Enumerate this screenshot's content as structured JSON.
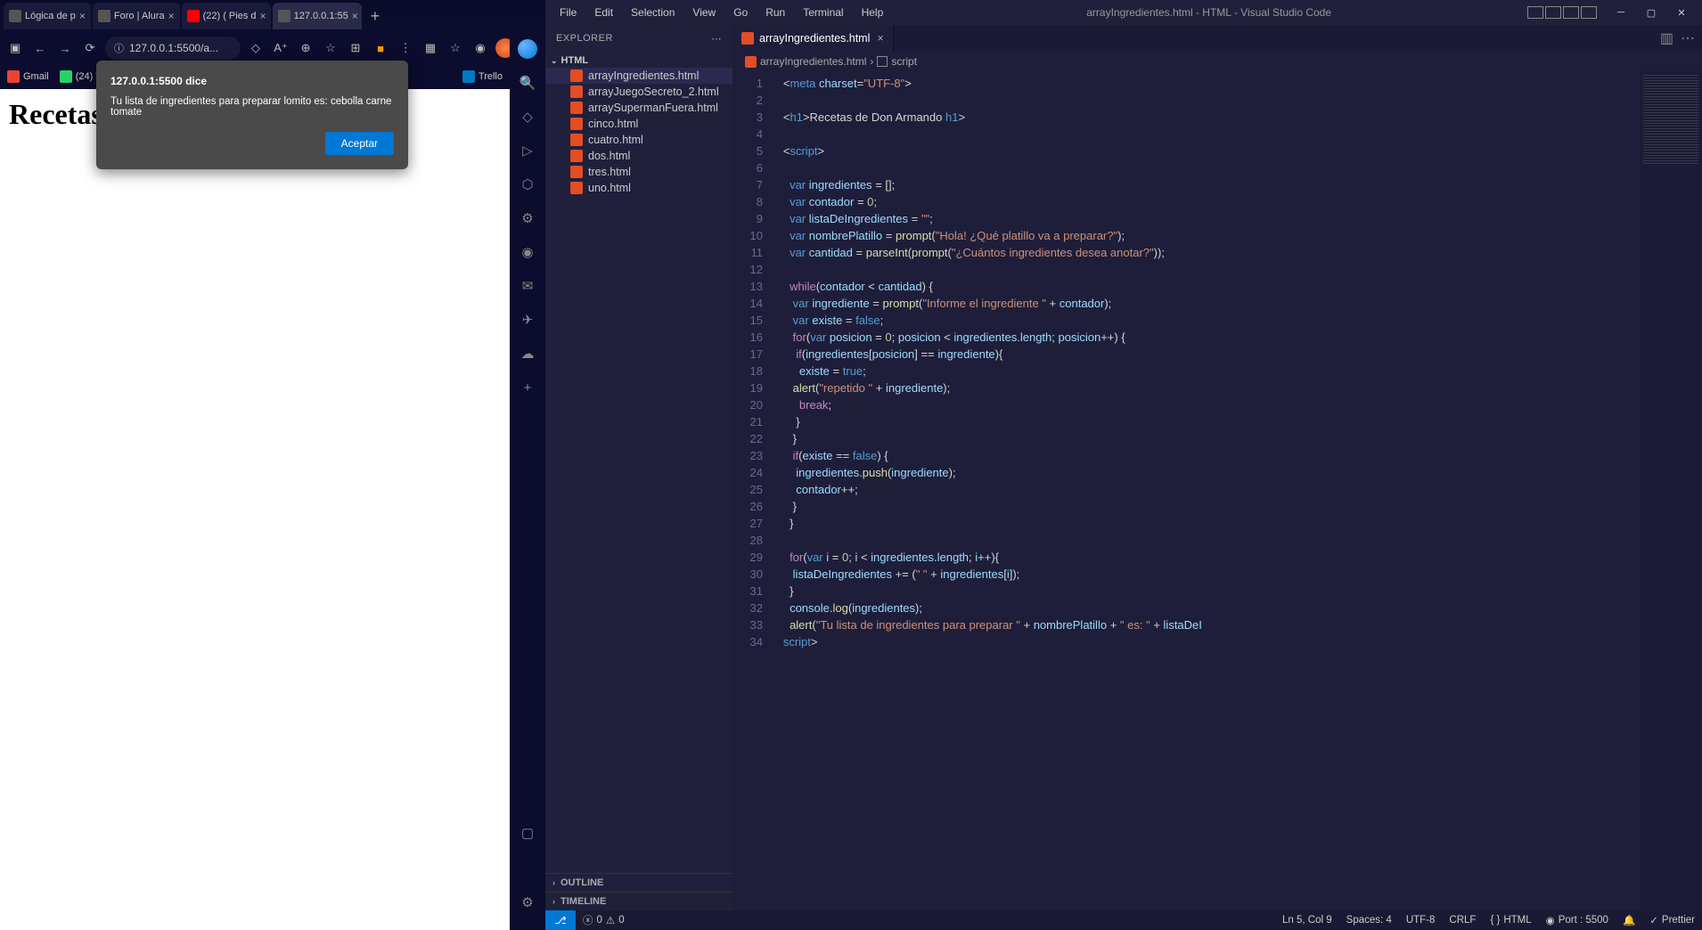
{
  "browser": {
    "tabs": [
      {
        "label": "Lógica de p"
      },
      {
        "label": "Foro | Alura"
      },
      {
        "label": "(22) ( Pies d"
      },
      {
        "label": "127.0.0.1:55",
        "active": true
      }
    ],
    "address": "127.0.0.1:5500/a...",
    "bookmarks": [
      {
        "label": "Gmail"
      },
      {
        "label": "(24) W"
      },
      {
        "label": "Trello"
      }
    ],
    "page_heading": "Recetas d",
    "alert": {
      "title": "127.0.0.1:5500 dice",
      "message": "Tu lista de ingredientes para preparar lomito es:  cebolla carne tomate",
      "button": "Aceptar"
    }
  },
  "vscode": {
    "menu": [
      "File",
      "Edit",
      "Selection",
      "View",
      "Go",
      "Run",
      "Terminal",
      "Help"
    ],
    "title": "arrayIngredientes.html - HTML - Visual Studio Code",
    "explorer_title": "EXPLORER",
    "folder": "HTML",
    "files": [
      "arrayIngredientes.html",
      "arrayJuegoSecreto_2.html",
      "arraySupermanFuera.html",
      "cinco.html",
      "cuatro.html",
      "dos.html",
      "tres.html",
      "uno.html"
    ],
    "outline": "OUTLINE",
    "timeline": "TIMELINE",
    "open_tab": "arrayIngredientes.html",
    "breadcrumb_file": "arrayIngredientes.html",
    "breadcrumb_symbol": "script",
    "line_count": 34,
    "status": {
      "errors": "0",
      "warnings": "0",
      "cursor": "Ln 5, Col 9",
      "spaces": "Spaces: 4",
      "encoding": "UTF-8",
      "eol": "CRLF",
      "lang": "HTML",
      "port": "Port : 5500",
      "prettier": "Prettier"
    },
    "code": {
      "l1": {
        "a": "<",
        "b": "meta ",
        "c": "charset",
        "d": "=",
        "e": "\"UTF-8\"",
        "f": ">"
      },
      "l3": {
        "a": "<",
        "b": "h1",
        "c": ">",
        "d": "Recetas de Don Armando ",
        "e": "</",
        "f": "h1",
        "g": ">"
      },
      "l5": {
        "a": "<",
        "b": "script",
        "c": ">"
      },
      "l7": {
        "a": "var ",
        "b": "ingredientes ",
        "c": "= [];"
      },
      "l8": {
        "a": "var ",
        "b": "contador ",
        "c": "= ",
        "d": "0",
        "e": ";"
      },
      "l9": {
        "a": "var ",
        "b": "listaDeIngredientes ",
        "c": "= ",
        "d": "\"\"",
        "e": ";"
      },
      "l10": {
        "a": "var ",
        "b": "nombrePlatillo ",
        "c": "= ",
        "d": "prompt",
        "e": "(",
        "f": "\"Hola! ¿Qué platillo va a preparar?\"",
        "g": ");"
      },
      "l11": {
        "a": "var ",
        "b": "cantidad ",
        "c": "= ",
        "d": "parseInt",
        "e": "(",
        "f": "prompt",
        "g": "(",
        "h": "\"¿Cuántos ingredientes desea anotar?\"",
        "i": "));"
      },
      "l13": {
        "a": "while",
        "b": "(",
        "c": "contador ",
        "d": "< ",
        "e": "cantidad",
        "f": ") {"
      },
      "l14": {
        "a": "var ",
        "b": "ingrediente ",
        "c": "= ",
        "d": "prompt",
        "e": "(",
        "f": "\"Informe el ingrediente \" ",
        "g": "+ ",
        "h": "contador",
        "i": ");"
      },
      "l15": {
        "a": "var ",
        "b": "existe ",
        "c": "= ",
        "d": "false",
        "e": ";"
      },
      "l16": {
        "a": "for",
        "b": "(",
        "c": "var ",
        "d": "posicion ",
        "e": "= ",
        "f": "0",
        "g": "; ",
        "h": "posicion ",
        "i": "< ",
        "j": "ingredientes",
        "k": ".",
        "l": "length",
        "m": "; ",
        "n": "posicion",
        "o": "++) {"
      },
      "l17": {
        "a": "if",
        "b": "(",
        "c": "ingredientes",
        "d": "[",
        "e": "posicion",
        "f": "] == ",
        "g": "ingrediente",
        "h": "){"
      },
      "l18": {
        "a": "existe ",
        "b": "= ",
        "c": "true",
        "d": ";"
      },
      "l19": {
        "a": "alert",
        "b": "(",
        "c": "\"repetido \" ",
        "d": "+ ",
        "e": "ingrediente",
        "f": ");"
      },
      "l20": {
        "a": "break",
        "b": ";"
      },
      "l21": "}",
      "l22": "}",
      "l23": {
        "a": "if",
        "b": "(",
        "c": "existe ",
        "d": "== ",
        "e": "false",
        "f": ") {"
      },
      "l24": {
        "a": "ingredientes",
        "b": ".",
        "c": "push",
        "d": "(",
        "e": "ingrediente",
        "f": ");"
      },
      "l25": {
        "a": "contador",
        "b": "++;"
      },
      "l26": "}",
      "l27": "}",
      "l29": {
        "a": "for",
        "b": "(",
        "c": "var ",
        "d": "i ",
        "e": "= ",
        "f": "0",
        "g": "; ",
        "h": "i ",
        "i": "< ",
        "j": "ingredientes",
        "k": ".",
        "l": "length",
        "m": "; ",
        "n": "i",
        "o": "++){"
      },
      "l30": {
        "a": "listaDeIngredientes ",
        "b": "+= (",
        "c": "\" \" ",
        "d": "+ ",
        "e": "ingredientes",
        "f": "[",
        "g": "i",
        "h": "]);"
      },
      "l31": "}",
      "l32": {
        "a": "console",
        "b": ".",
        "c": "log",
        "d": "(",
        "e": "ingredientes",
        "f": ");"
      },
      "l33": {
        "a": "alert",
        "b": "(",
        "c": "\"Tu lista de ingredientes para preparar \" ",
        "d": "+ ",
        "e": "nombrePlatillo ",
        "f": "+ ",
        "g": "\" es: \" ",
        "h": "+ ",
        "i": "listaDeI"
      },
      "l34": {
        "a": "</",
        "b": "script",
        "c": ">"
      }
    }
  }
}
